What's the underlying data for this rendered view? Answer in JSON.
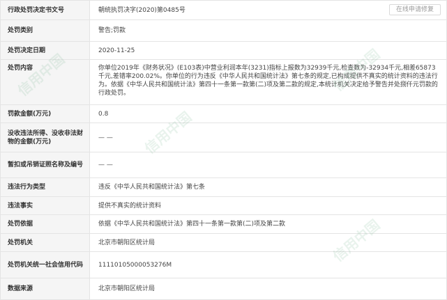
{
  "repair_button_label": "在线申请修复",
  "rows": [
    {
      "label": "行政处罚决定书文号",
      "value": "朝统执罚决字(2020)第0485号"
    },
    {
      "label": "处罚类别",
      "value": "警告;罚款"
    },
    {
      "label": "处罚决定日期",
      "value": "2020-11-25"
    },
    {
      "label": "处罚内容",
      "value": "你单位2019年《财务状况》(E103表)中营业利润本年(3231)指标上报数为32939千元,检查数为-32934千元,相差65873千元,差错率200.02%。你单位的行为违反《中华人民共和国统计法》第七条的规定,已构成提供不真实的统计资料的违法行为。依据《中华人民共和国统计法》第四十一条第一款第(二)项及第二款的规定,本统计机关决定给予警告并处捌仟元罚款的行政处罚。"
    },
    {
      "label": "罚款金额(万元)",
      "value": "0.8"
    },
    {
      "label": "没收违法所得、没收非法财物的金额(万元)",
      "value": "— —"
    },
    {
      "label": "暂扣或吊销证照名称及编号",
      "value": "— —"
    },
    {
      "label": "违法行为类型",
      "value": "违反《中华人民共和国统计法》第七条"
    },
    {
      "label": "违法事实",
      "value": "提供不真实的统计资料"
    },
    {
      "label": "处罚依据",
      "value": "依据《中华人民共和国统计法》第四十一条第一款第(二)项及第二款"
    },
    {
      "label": "处罚机关",
      "value": "北京市朝阳区统计局"
    },
    {
      "label": "处罚机关统一社会信用代码",
      "value": "11110105000053276M"
    },
    {
      "label": "数据来源",
      "value": "北京市朝阳区统计局"
    }
  ],
  "watermark_text": "信用中国"
}
